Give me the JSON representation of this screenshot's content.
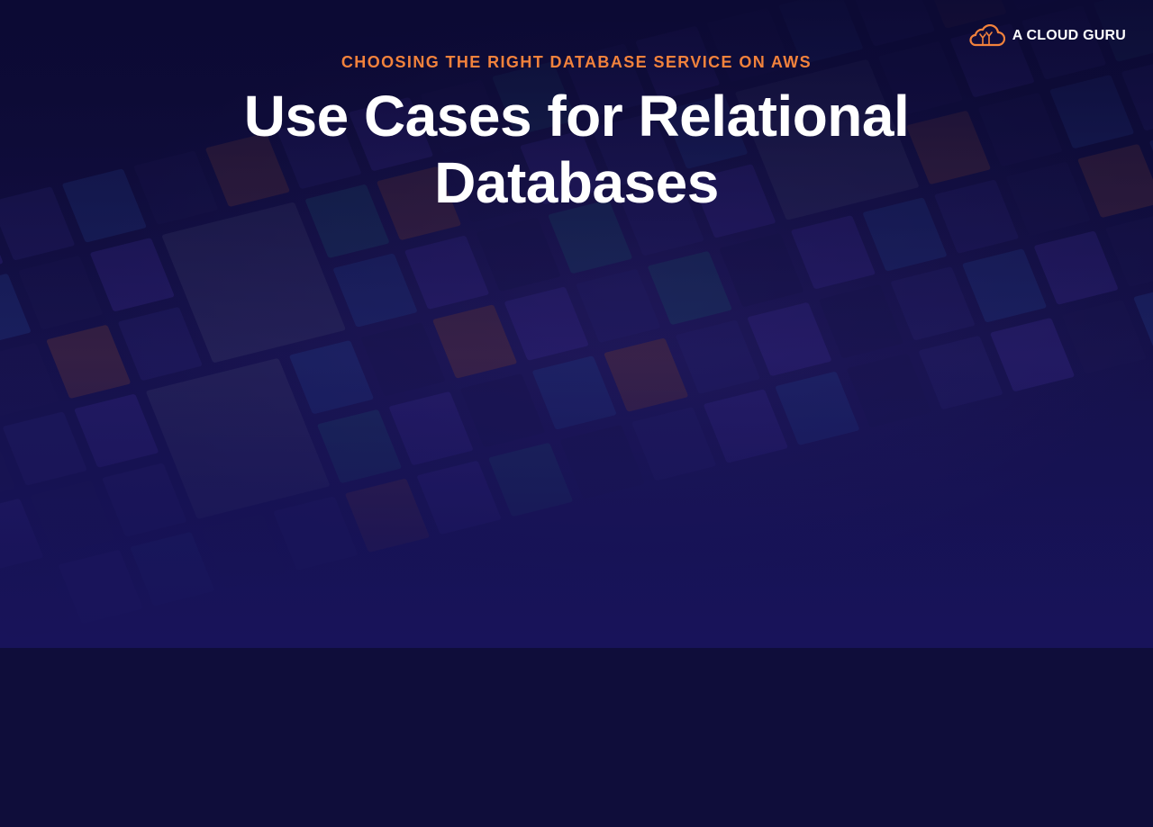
{
  "slide": {
    "eyebrow": "CHOOSING THE RIGHT DATABASE SERVICE ON AWS",
    "title": "Use Cases for Relational Databases"
  },
  "brand": {
    "logo_text": "A CLOUD GURU",
    "logo_icon": "cloud-logo-icon",
    "accent_color": "#f2823c"
  },
  "colors": {
    "background": "#0f0d3a",
    "title": "#ffffff"
  }
}
